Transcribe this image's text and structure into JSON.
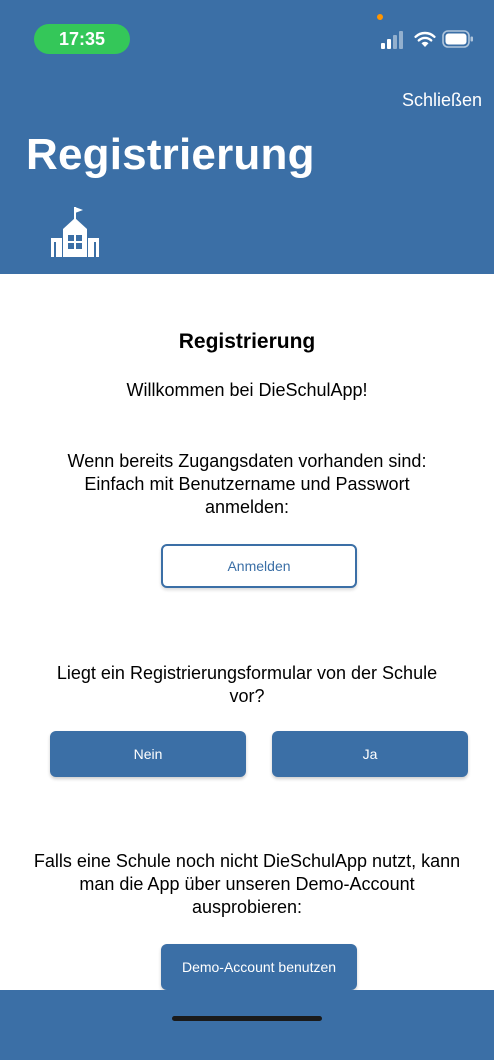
{
  "status_bar": {
    "time": "17:35",
    "icons": [
      "signal-icon",
      "wifi-icon",
      "battery-icon"
    ]
  },
  "header": {
    "close_label": "Schließen",
    "title": "Registrierung",
    "icon": "school-building-icon"
  },
  "content": {
    "title": "Registrierung",
    "welcome": "Willkommen bei DieSchulApp!",
    "credentials_text": "Wenn bereits Zugangsdaten vorhanden sind: Einfach mit Benutzername und Passwort anmelden:",
    "login_label": "Anmelden",
    "form_question": "Liegt ein Registrierungsformular von der Schule vor?",
    "no_label": "Nein",
    "yes_label": "Ja",
    "demo_text": "Falls eine Schule noch nicht DieSchulApp nutzt, kann man die App über unseren Demo-Account ausprobieren:",
    "demo_label": "Demo-Account benutzen"
  },
  "colors": {
    "primary": "#3b6fa6",
    "time_pill": "#34c759",
    "privacy_dot": "#ff9500"
  }
}
